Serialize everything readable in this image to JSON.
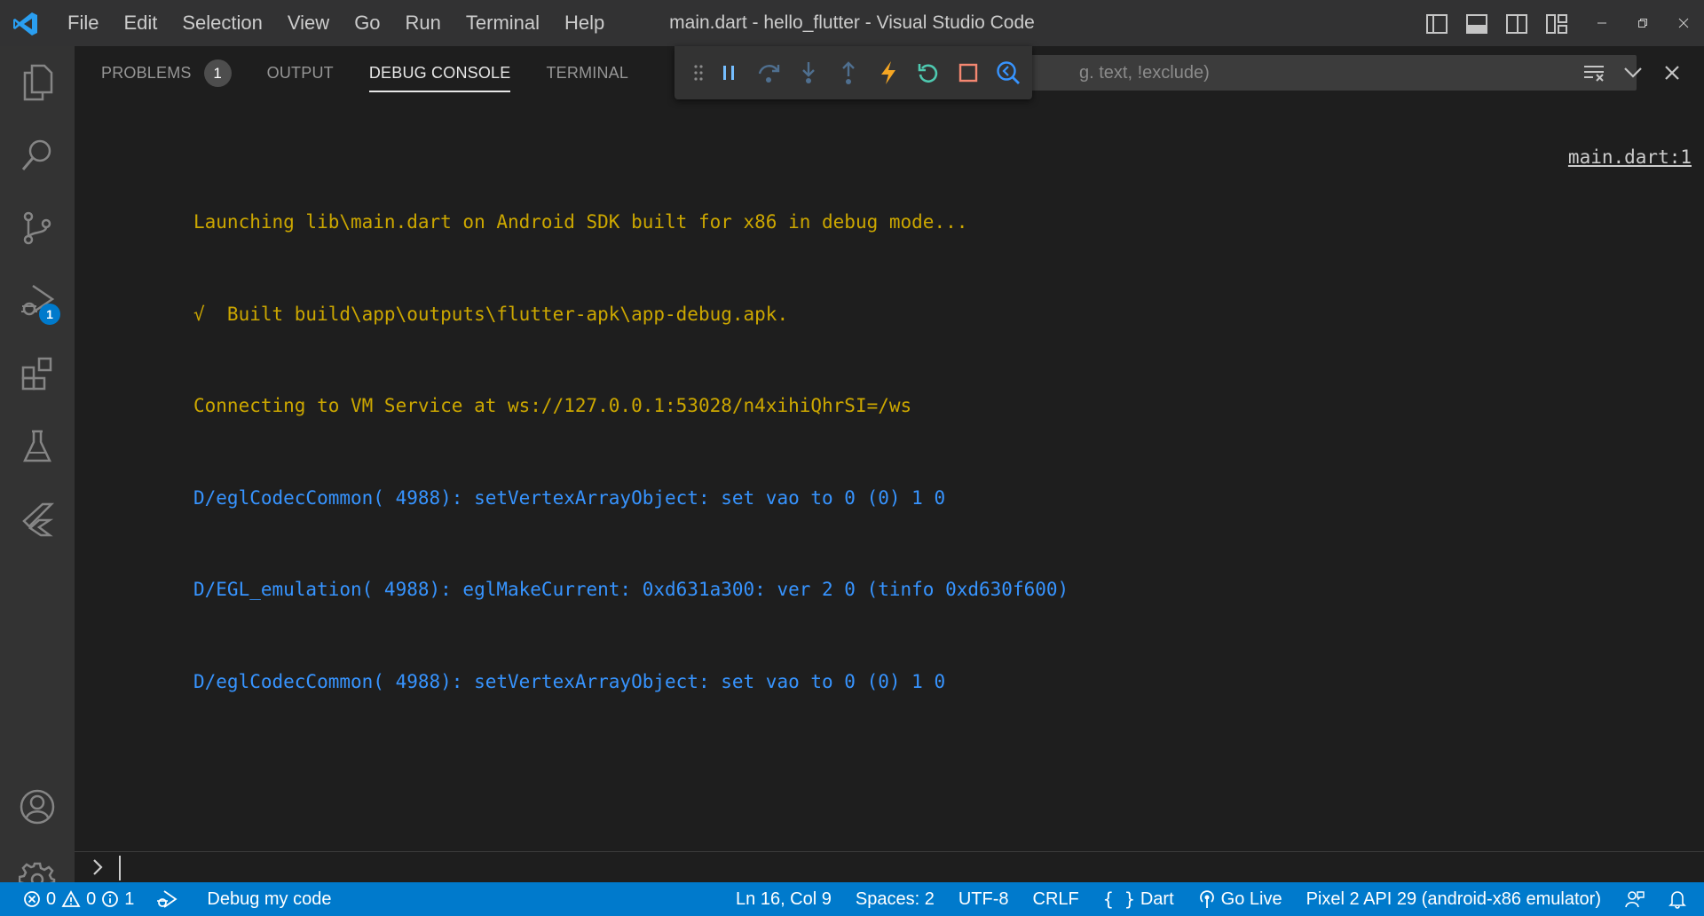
{
  "window": {
    "title": "main.dart - hello_flutter - Visual Studio Code",
    "accent": "#007acc"
  },
  "menu": [
    "File",
    "Edit",
    "Selection",
    "View",
    "Go",
    "Run",
    "Terminal",
    "Help"
  ],
  "activity_bar": {
    "items": [
      "explorer-icon",
      "search-icon",
      "source-control-icon",
      "run-debug-icon",
      "extensions-icon",
      "testing-icon",
      "flutter-icon"
    ],
    "debug_badge": "1",
    "bottom": [
      "accounts-icon",
      "settings-gear-icon"
    ]
  },
  "panel": {
    "tabs": [
      {
        "label": "PROBLEMS",
        "badge": "1"
      },
      {
        "label": "OUTPUT"
      },
      {
        "label": "DEBUG CONSOLE",
        "active": true
      },
      {
        "label": "TERMINAL"
      }
    ],
    "filter_placeholder": "g. text, !exclude)"
  },
  "debug_toolbar": [
    "drag-grip-icon",
    "pause-icon",
    "step-over-icon",
    "step-into-icon",
    "step-out-icon",
    "hot-reload-icon",
    "hot-restart-icon",
    "stop-icon",
    "devtools-icon"
  ],
  "console": {
    "lines": [
      {
        "text": "Launching lib\\main.dart on Android SDK built for x86 in debug mode...",
        "color": "#cca700"
      },
      {
        "text": "√  Built build\\app\\outputs\\flutter-apk\\app-debug.apk.",
        "color": "#cca700"
      },
      {
        "text": "Connecting to VM Service at ws://127.0.0.1:53028/n4xihiQhrSI=/ws",
        "color": "#cca700"
      },
      {
        "text": "D/eglCodecCommon( 4988): setVertexArrayObject: set vao to 0 (0) 1 0",
        "color": "#3794ff"
      },
      {
        "text": "D/EGL_emulation( 4988): eglMakeCurrent: 0xd631a300: ver 2 0 (tinfo 0xd630f600)",
        "color": "#3794ff"
      },
      {
        "text": "D/eglCodecCommon( 4988): setVertexArrayObject: set vao to 0 (0) 1 0",
        "color": "#3794ff"
      }
    ],
    "source_link": "main.dart:1"
  },
  "statusbar": {
    "errors": "0",
    "warnings": "0",
    "infos": "1",
    "debug_label": "Debug my code",
    "position": "Ln 16, Col 9",
    "spaces": "Spaces: 2",
    "encoding": "UTF-8",
    "eol": "CRLF",
    "language": "Dart",
    "go_live": "Go Live",
    "device": "Pixel 2 API 29 (android-x86 emulator)"
  }
}
